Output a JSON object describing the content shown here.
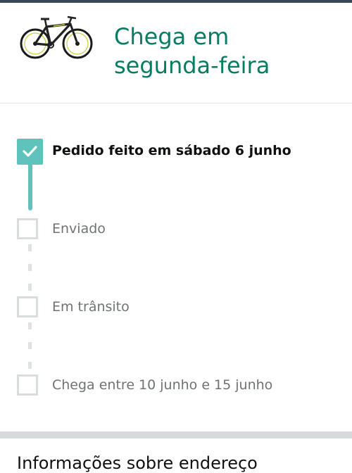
{
  "header": {
    "product_image_icon": "bicycle-icon",
    "delivery_line1": "Chega em",
    "delivery_line2": "segunda-feira"
  },
  "tracker": {
    "steps": [
      {
        "label": "Pedido feito em sábado 6 junho",
        "completed": true
      },
      {
        "label": "Enviado",
        "completed": false
      },
      {
        "label": "Em trânsito",
        "completed": false
      },
      {
        "label": "Chega entre 10 junho e 15 junho",
        "completed": false
      }
    ]
  },
  "address_section": {
    "title": "Informações sobre endereço"
  },
  "colors": {
    "accent": "#067d62",
    "progress": "#5dc3bb",
    "pending_border": "#dadddd",
    "top_bar": "#37475a"
  }
}
